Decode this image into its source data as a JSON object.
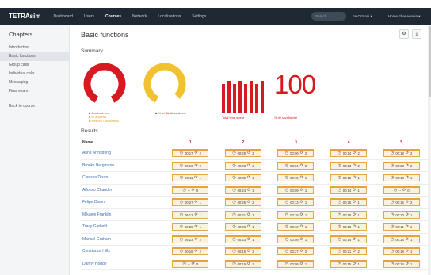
{
  "app": {
    "brand": "TETRAsim"
  },
  "nav": {
    "items": [
      {
        "label": "Dashboard",
        "active": false
      },
      {
        "label": "Users",
        "active": false
      },
      {
        "label": "Courses",
        "active": true
      },
      {
        "label": "Network",
        "active": false
      },
      {
        "label": "Localizations",
        "active": false
      },
      {
        "label": "Settings",
        "active": false
      }
    ],
    "search_placeholder": "Search",
    "user_org": "Fe Ortaani ▾",
    "user_name": "Home Fhanaonnia ▾"
  },
  "sidebar": {
    "title": "Chapters",
    "items": [
      {
        "label": "Introduction",
        "active": false
      },
      {
        "label": "Basic functions",
        "active": true
      },
      {
        "label": "Group calls",
        "active": false
      },
      {
        "label": "Individual calls",
        "active": false
      },
      {
        "label": "Messaging",
        "active": false
      },
      {
        "label": "Final exam",
        "active": false
      }
    ],
    "back_label": "Back to course"
  },
  "main": {
    "title": "Basic functions",
    "settings_icon": "gear-icon",
    "download_icon": "download-icon"
  },
  "summary": {
    "title": "Summary",
    "gauges": [
      {
        "name": "completion",
        "color": "#d71920",
        "fraction": 0.85,
        "caption": [
          "■ Onvimat ser",
          "■ Ei aloitettu",
          "■ Kesken Oikotiealuo"
        ],
        "caption_colors": [
          "#d71920",
          "#e0a030",
          "#e0a030"
        ]
      },
      {
        "name": "success",
        "color": "#f2c12e",
        "fraction": 0.8,
        "caption": [
          "■ % tehtävät keskeen"
        ],
        "caption_colors": [
          "#d71920"
        ]
      }
    ],
    "bars": {
      "count": 8,
      "caption": "Total time spent",
      "color": "#d71920"
    },
    "big_number": {
      "value": "100",
      "caption": "% de tavalla visi"
    }
  },
  "results": {
    "title": "Results",
    "name_header": "Name",
    "question_headers": [
      "1",
      "2",
      "3",
      "4",
      "5"
    ],
    "rows": [
      {
        "name": "Anne Armstrong",
        "cells": [
          [
            "00:17",
            "2"
          ],
          [
            "00:28",
            "2"
          ],
          [
            "00:09",
            "2"
          ],
          [
            "00:14",
            "2"
          ],
          [
            "00:18",
            "2"
          ]
        ]
      },
      {
        "name": "Brooks Bergmann",
        "cells": [
          [
            "00:19",
            "2"
          ],
          [
            "00:28",
            "2"
          ],
          [
            "03:24",
            "2"
          ],
          [
            "03:23",
            "2"
          ],
          [
            "03:23",
            "2"
          ]
        ]
      },
      {
        "name": "Clarissa Dixon",
        "cells": [
          [
            "00:11",
            "1"
          ],
          [
            "00:39",
            "1"
          ],
          [
            "00:15",
            "1"
          ],
          [
            "00:15",
            "1"
          ],
          [
            "00:18",
            "1"
          ]
        ]
      },
      {
        "name": "Alfonso Chandor",
        "cells": [
          [
            "--",
            "0"
          ],
          [
            "00:24",
            "1"
          ],
          [
            "03:09",
            "1"
          ],
          [
            "00:14",
            "1"
          ],
          [
            "--",
            "0"
          ]
        ]
      },
      {
        "name": "Felipe Dixon",
        "cells": [
          [
            "00:27",
            "1"
          ],
          [
            "00:25",
            "2"
          ],
          [
            "00:13",
            "1"
          ],
          [
            "00:25",
            "1"
          ],
          [
            "00:16",
            "2"
          ]
        ]
      },
      {
        "name": "Mikaele Franklin",
        "cells": [
          [
            "06:12",
            "1"
          ],
          [
            "00:21",
            "1"
          ],
          [
            "03:18",
            "1"
          ],
          [
            "00:18",
            "1"
          ],
          [
            "00:10",
            "1"
          ]
        ]
      },
      {
        "name": "Tracy Garfield",
        "cells": [
          [
            "00:25",
            "1"
          ],
          [
            "00:06",
            "1"
          ],
          [
            "03:10",
            "1"
          ],
          [
            "00:18",
            "1"
          ],
          [
            "00:11",
            "1"
          ]
        ]
      },
      {
        "name": "Manuel Graham",
        "cells": [
          [
            "06:23",
            "2"
          ],
          [
            "00:23",
            "1"
          ],
          [
            "03:09",
            "1"
          ],
          [
            "00:14",
            "1"
          ],
          [
            "00:14",
            "1"
          ]
        ]
      },
      {
        "name": "Constance Hills",
        "cells": [
          [
            "00:18",
            "2"
          ],
          [
            "00:15",
            "2"
          ],
          [
            "03:27",
            "2"
          ],
          [
            "00:21",
            "2"
          ],
          [
            "00:18",
            "1"
          ]
        ]
      },
      {
        "name": "Danny Hodge",
        "cells": [
          [
            "--",
            "0"
          ],
          [
            "00:19",
            "1"
          ],
          [
            "03:09",
            "1"
          ],
          [
            "00:15",
            "1"
          ],
          [
            "00:14",
            "1"
          ]
        ]
      }
    ]
  },
  "colors": {
    "accent_red": "#d71920",
    "accent_yellow": "#f2c12e",
    "cell_bg": "#fbf2dd",
    "cell_border": "#e8a23a",
    "link_blue": "#3b6fb4",
    "navbar_bg": "#1f2933"
  },
  "icons": {
    "time": "clock-icon",
    "attempts": "refresh-icon"
  }
}
